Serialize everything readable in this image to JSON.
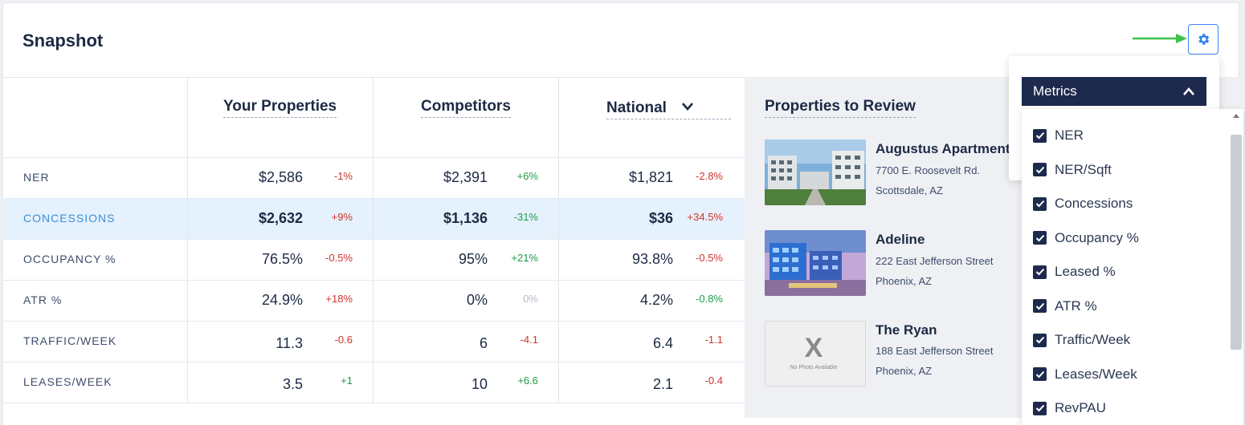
{
  "title": "Snapshot",
  "columns": [
    "Your Properties",
    "Competitors",
    "National"
  ],
  "rows": [
    {
      "label": "NER",
      "values": [
        "$2,586",
        "$2,391",
        "$1,821"
      ],
      "changes": [
        "-1%",
        "+6%",
        "-2.8%"
      ],
      "tones": [
        "neg",
        "pos",
        "neg"
      ]
    },
    {
      "label": "CONCESSIONS",
      "values": [
        "$2,632",
        "$1,136",
        "$36"
      ],
      "changes": [
        "+9%",
        "-31%",
        "+34.5%"
      ],
      "tones": [
        "neg",
        "pos",
        "neg"
      ],
      "highlighted": true
    },
    {
      "label": "OCCUPANCY %",
      "values": [
        "76.5%",
        "95%",
        "93.8%"
      ],
      "changes": [
        "-0.5%",
        "+21%",
        "-0.5%"
      ],
      "tones": [
        "neg",
        "pos",
        "neg"
      ]
    },
    {
      "label": "ATR %",
      "values": [
        "24.9%",
        "0%",
        "4.2%"
      ],
      "changes": [
        "+18%",
        "0%",
        "-0.8%"
      ],
      "tones": [
        "neg",
        "zero",
        "pos"
      ]
    },
    {
      "label": "TRAFFIC/WEEK",
      "values": [
        "11.3",
        "6",
        "6.4"
      ],
      "changes": [
        "-0.6",
        "-4.1",
        "-1.1"
      ],
      "tones": [
        "neg",
        "neg",
        "neg"
      ]
    },
    {
      "label": "LEASES/WEEK",
      "values": [
        "3.5",
        "10",
        "2.1"
      ],
      "changes": [
        "+1",
        "+6.6",
        "-0.4"
      ],
      "tones": [
        "pos",
        "pos",
        "neg"
      ]
    }
  ],
  "review": {
    "title": "Properties to Review",
    "properties": [
      {
        "name": "Augustus Apartments",
        "street": "7700 E. Roosevelt Rd.",
        "city": "Scottsdale, AZ"
      },
      {
        "name": "Adeline",
        "street": "222 East Jefferson Street",
        "city": "Phoenix, AZ"
      },
      {
        "name": "The Ryan",
        "street": "188 East Jefferson Street",
        "city": "Phoenix, AZ",
        "no_photo": "No Photo Available"
      }
    ]
  },
  "metrics": {
    "header": "Metrics",
    "items": [
      "NER",
      "NER/Sqft",
      "Concessions",
      "Occupancy %",
      "Leased %",
      "ATR %",
      "Traffic/Week",
      "Leases/Week",
      "RevPAU"
    ]
  },
  "colors": {
    "navy": "#1d2a4d",
    "negative": "#d0342c",
    "positive": "#1e9c4a",
    "highlight": "#e5f1fc",
    "accent": "#3b82f6",
    "arrow": "#3cc24a"
  },
  "icons": {
    "settings": "gear-icon",
    "national_dropdown": "chevron-down-icon",
    "metrics_collapse": "chevron-up-icon",
    "annotation": "green-arrow-icon"
  }
}
